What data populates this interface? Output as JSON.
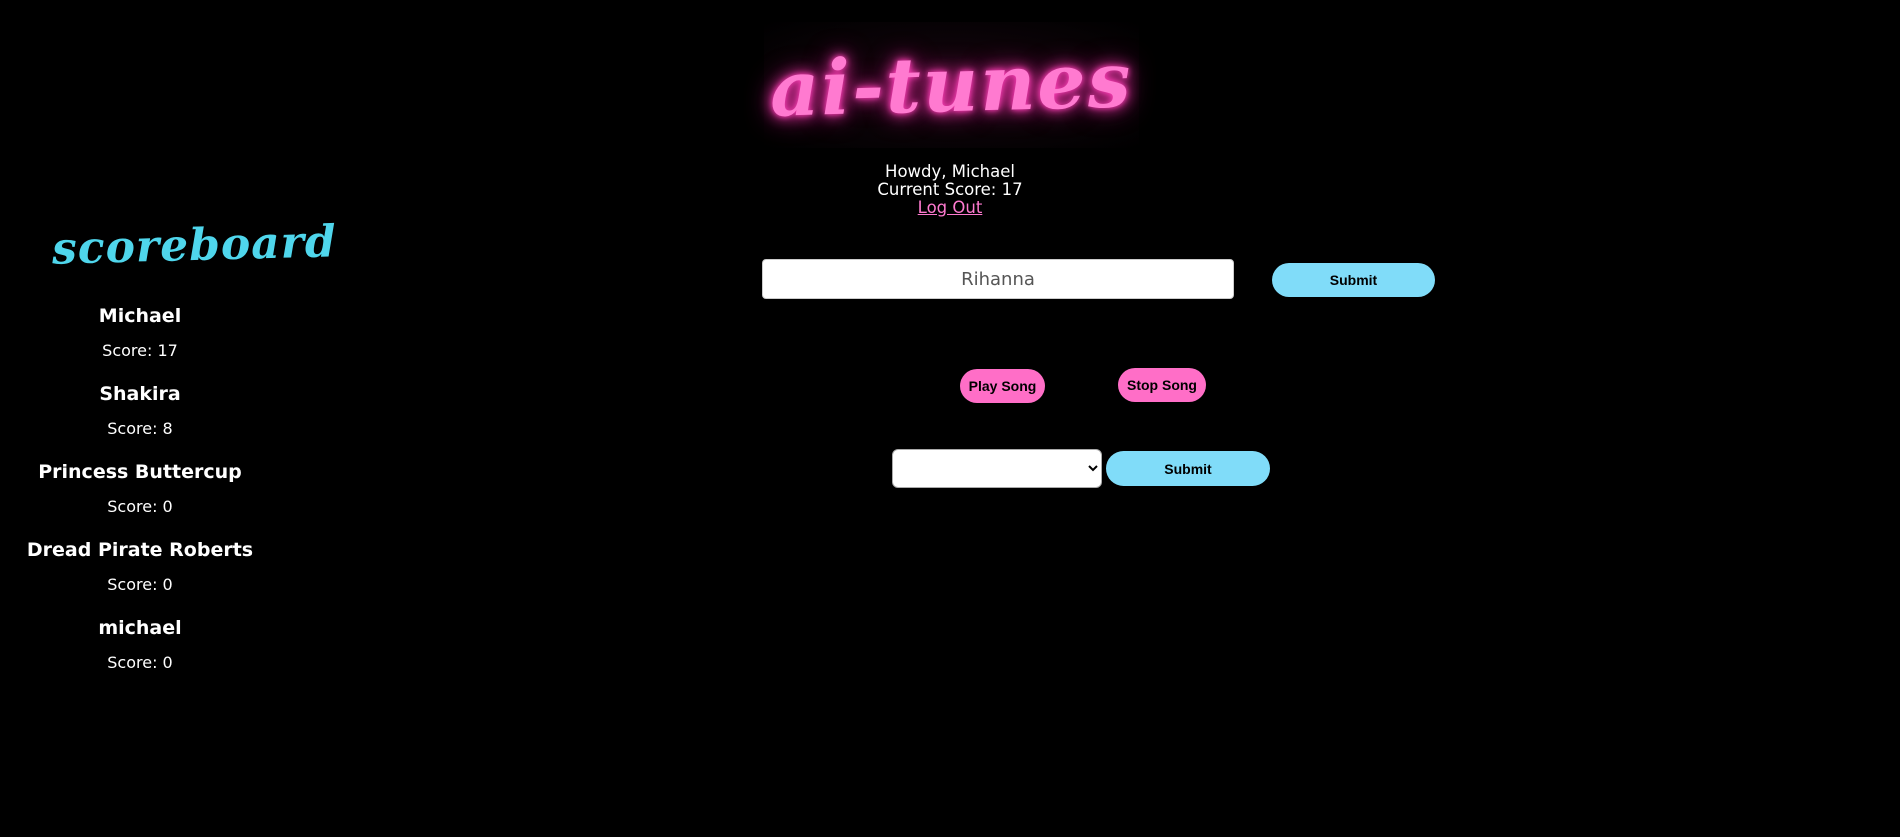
{
  "header": {
    "logo_text": "ai-tunes",
    "greeting": "Howdy, Michael",
    "current_score": "Current Score: 17",
    "logout_label": "Log Out"
  },
  "scoreboard": {
    "title": "scoreboard",
    "players": [
      {
        "name": "Michael",
        "score": "Score: 17"
      },
      {
        "name": "Shakira",
        "score": "Score: 8"
      },
      {
        "name": "Princess Buttercup",
        "score": "Score: 0"
      },
      {
        "name": "Dread Pirate Roberts",
        "score": "Score: 0"
      },
      {
        "name": "michael",
        "score": "Score: 0"
      }
    ]
  },
  "guess_form": {
    "input_value": "Rihanna",
    "submit_label": "Submit"
  },
  "player_controls": {
    "play_label": "Play Song",
    "stop_label": "Stop Song"
  },
  "answer_form": {
    "selected_value": "",
    "submit_label": "Submit"
  },
  "colors": {
    "background": "#000000",
    "logo_pink": "#ff7ad0",
    "scoreboard_cyan": "#4fd6ec",
    "button_blue": "#80dcf9",
    "button_pink": "#ff6ec7",
    "link_pink": "#ff7ad0"
  }
}
